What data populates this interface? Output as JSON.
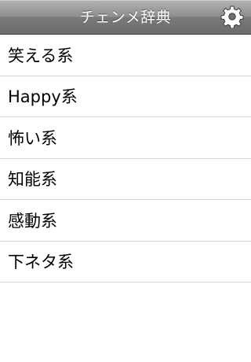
{
  "navbar": {
    "title": "チェンメ辞典",
    "settings_icon": "gear-icon"
  },
  "list": {
    "items": [
      {
        "label": "笑える系"
      },
      {
        "label": "Happy系"
      },
      {
        "label": "怖い系"
      },
      {
        "label": "知能系"
      },
      {
        "label": "感動系"
      },
      {
        "label": "下ネタ系"
      }
    ]
  },
  "colors": {
    "navbar_top": "#b3b3b3",
    "navbar_bottom": "#6b6b6b",
    "separator": "#d3d3d3",
    "background": "#ffffff"
  }
}
